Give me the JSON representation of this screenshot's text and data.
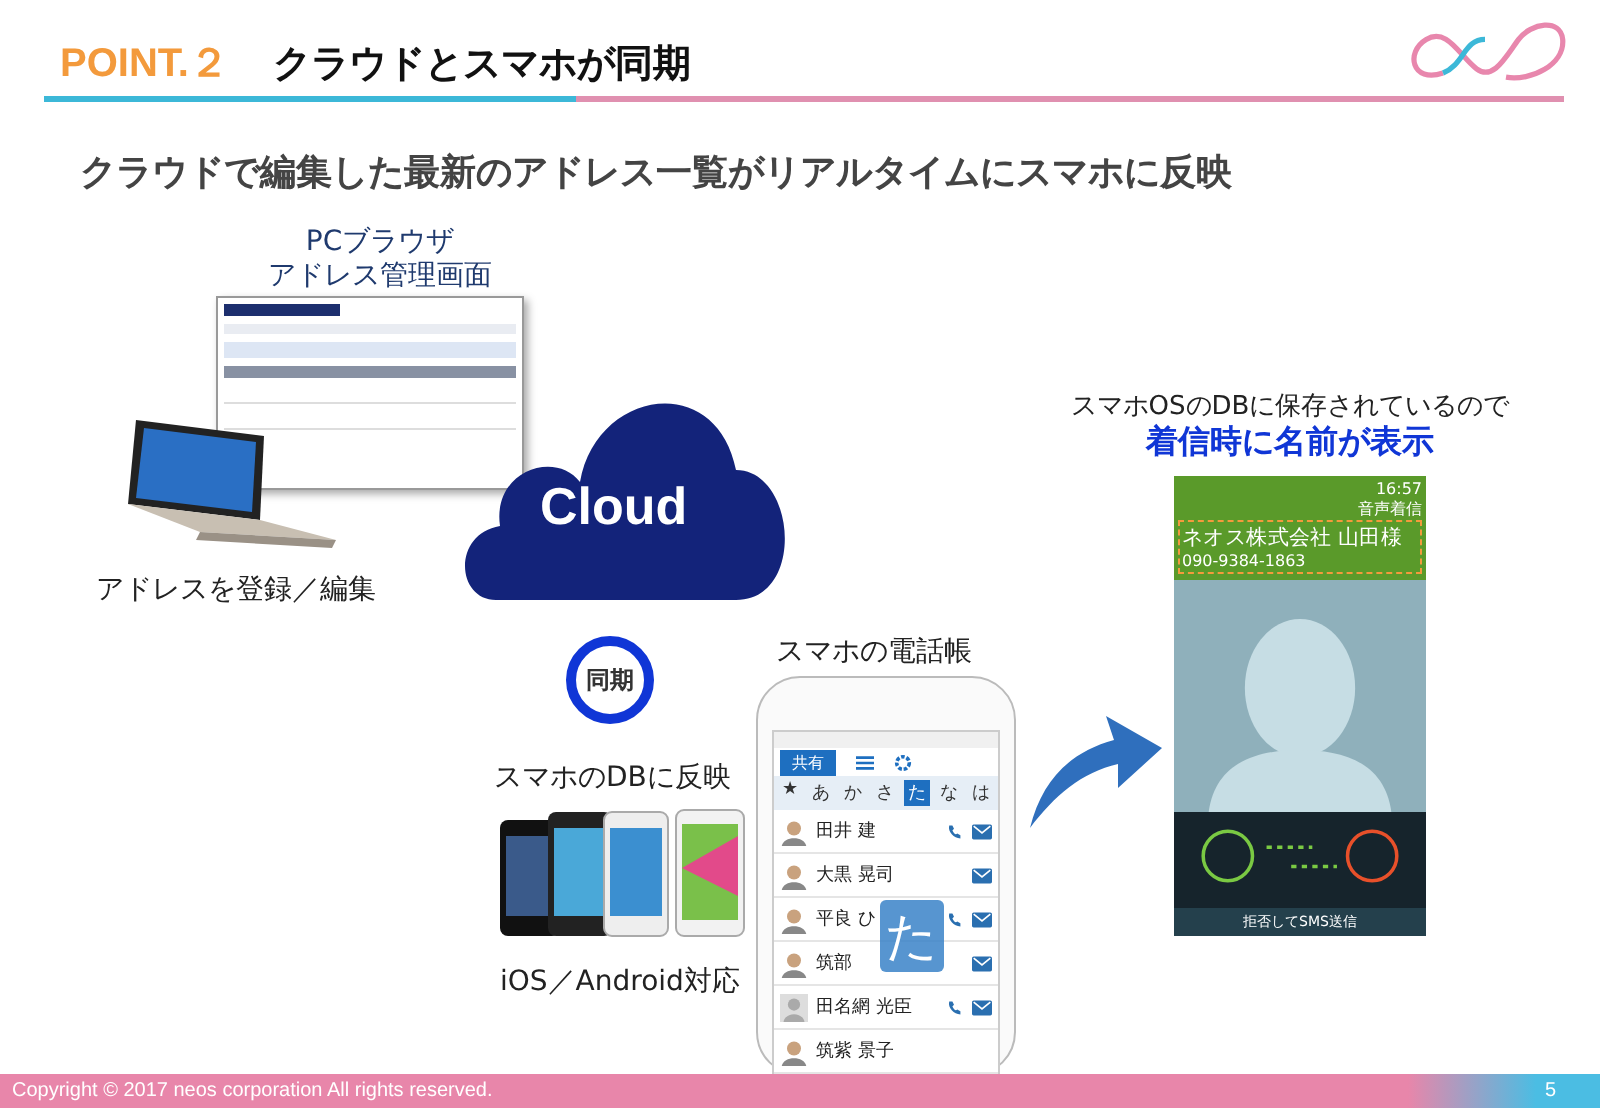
{
  "header": {
    "point": "POINT.２",
    "title": "クラウドとスマホが同期"
  },
  "subtitle": "クラウドで編集した最新のアドレス一覧がリアルタイムにスマホに反映",
  "pc": {
    "caption_lines": [
      "PCブラウザ",
      "アドレス管理画面"
    ],
    "caption_below": "アドレスを登録／編集"
  },
  "cloud": {
    "label": "Cloud"
  },
  "sync": {
    "badge": "同期",
    "caption": "スマホのDBに反映",
    "devices_caption": "iOS／Android対応"
  },
  "contacts_phone": {
    "title": "スマホの電話帳",
    "tab": "共有",
    "index": [
      {
        "label": "★",
        "selected": false
      },
      {
        "label": "あ",
        "selected": false
      },
      {
        "label": "か",
        "selected": false
      },
      {
        "label": "さ",
        "selected": false
      },
      {
        "label": "た",
        "selected": true
      },
      {
        "label": "な",
        "selected": false
      },
      {
        "label": "は",
        "selected": false
      }
    ],
    "contacts": [
      {
        "name": "田井 建",
        "kind": "person",
        "phone": true,
        "mail": true
      },
      {
        "name": "大黒 晃司",
        "kind": "person",
        "phone": false,
        "mail": true
      },
      {
        "name": "平良 ひ",
        "kind": "person",
        "phone": true,
        "mail": true
      },
      {
        "name": "筑部",
        "kind": "person",
        "phone": false,
        "mail": true
      },
      {
        "name": "田名網 光臣",
        "kind": "blank",
        "phone": true,
        "mail": true
      },
      {
        "name": "筑紫 景子",
        "kind": "person",
        "phone": false,
        "mail": false
      }
    ],
    "overlay": "た"
  },
  "incoming": {
    "caption": "スマホOSのDBに保存されているので",
    "caption_emphasis": "着信時に名前が表示",
    "status_time": "16:57",
    "call_type": "音声着信",
    "caller": "ネオス株式会社 山田様",
    "number": "090-9384-1863",
    "hint": "拒否してSMS送信"
  },
  "footer": {
    "copyright": "Copyright © 2017  neos corporation  All rights reserved.",
    "page": "5"
  }
}
